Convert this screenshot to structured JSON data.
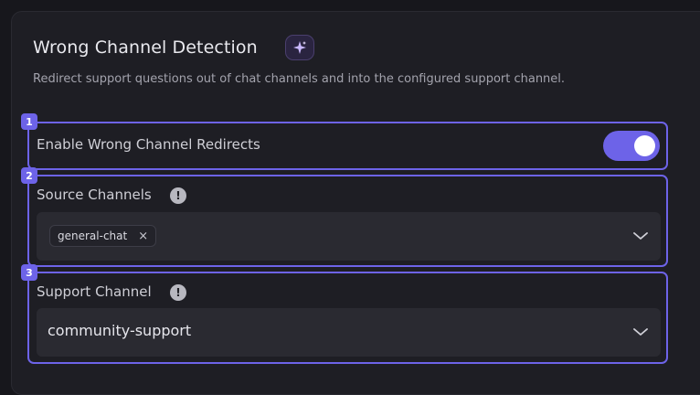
{
  "header": {
    "title": "Wrong Channel Detection",
    "subtitle": "Redirect support questions out of chat channels and into the configured support channel."
  },
  "sections": [
    {
      "marker": "1",
      "label": "Enable Wrong Channel Redirects",
      "toggle_on": true
    },
    {
      "marker": "2",
      "label": "Source Channels",
      "info": "!",
      "chips": [
        {
          "label": "general-chat",
          "remove": "×"
        }
      ]
    },
    {
      "marker": "3",
      "label": "Support Channel",
      "info": "!",
      "value": "community-support"
    }
  ],
  "colors": {
    "accent": "#6d63e8",
    "background": "#17171c",
    "panel": "#1e1e24",
    "field": "#2a2a31"
  },
  "icons": {
    "title_badge": "sparkle-icon",
    "info": "info-icon",
    "dropdown": "chevron-down-icon",
    "chip_remove": "close-icon"
  }
}
